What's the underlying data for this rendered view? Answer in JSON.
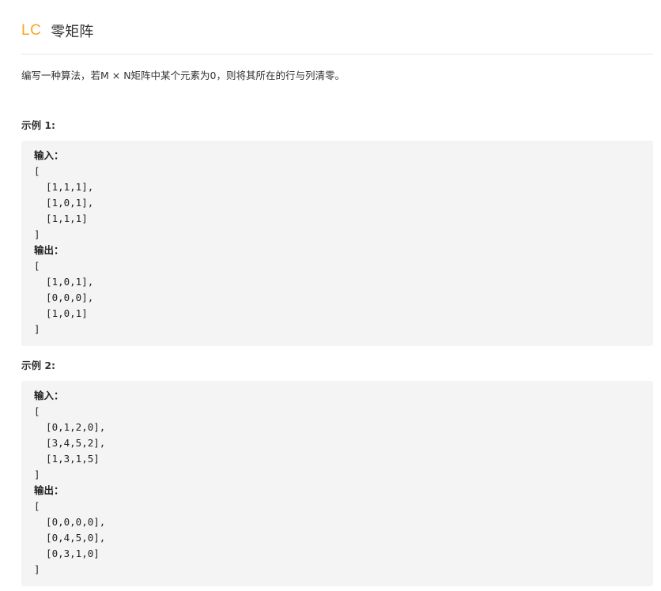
{
  "header": {
    "badge": "LC",
    "title": "零矩阵"
  },
  "description": "编写一种算法，若M × N矩阵中某个元素为0，则将其所在的行与列清零。",
  "examples": [
    {
      "label": "示例 1:",
      "lines": [
        {
          "text": "输入：",
          "bold": true
        },
        {
          "text": "[",
          "bold": false
        },
        {
          "text": "  [1,1,1],",
          "bold": false
        },
        {
          "text": "  [1,0,1],",
          "bold": false
        },
        {
          "text": "  [1,1,1]",
          "bold": false
        },
        {
          "text": "]",
          "bold": false
        },
        {
          "text": "输出：",
          "bold": true
        },
        {
          "text": "[",
          "bold": false
        },
        {
          "text": "  [1,0,1],",
          "bold": false
        },
        {
          "text": "  [0,0,0],",
          "bold": false
        },
        {
          "text": "  [1,0,1]",
          "bold": false
        },
        {
          "text": "]",
          "bold": false
        }
      ]
    },
    {
      "label": "示例 2:",
      "lines": [
        {
          "text": "输入：",
          "bold": true
        },
        {
          "text": "[",
          "bold": false
        },
        {
          "text": "  [0,1,2,0],",
          "bold": false
        },
        {
          "text": "  [3,4,5,2],",
          "bold": false
        },
        {
          "text": "  [1,3,1,5]",
          "bold": false
        },
        {
          "text": "]",
          "bold": false
        },
        {
          "text": "输出：",
          "bold": true
        },
        {
          "text": "[",
          "bold": false
        },
        {
          "text": "  [0,0,0,0],",
          "bold": false
        },
        {
          "text": "  [0,4,5,0],",
          "bold": false
        },
        {
          "text": "  [0,3,1,0]",
          "bold": false
        },
        {
          "text": "]",
          "bold": false
        }
      ]
    }
  ]
}
